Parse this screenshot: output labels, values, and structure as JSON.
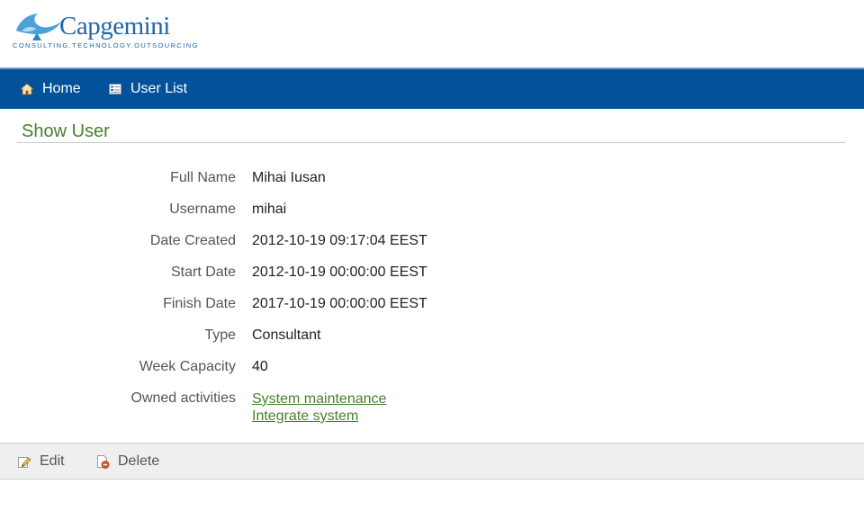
{
  "brand": {
    "name": "Capgemini",
    "tagline": "CONSULTING.TECHNOLOGY.OUTSOURCING",
    "color": "#2166ac"
  },
  "nav": {
    "items": [
      {
        "label": "Home",
        "icon": "home-icon"
      },
      {
        "label": "User List",
        "icon": "list-icon"
      }
    ],
    "background": "#01529b"
  },
  "page": {
    "title": "Show User"
  },
  "user": {
    "fields": [
      {
        "label": "Full Name",
        "value": "Mihai Iusan"
      },
      {
        "label": "Username",
        "value": "mihai"
      },
      {
        "label": "Date Created",
        "value": "2012-10-19 09:17:04 EEST"
      },
      {
        "label": "Start Date",
        "value": "2012-10-19 00:00:00 EEST"
      },
      {
        "label": "Finish Date",
        "value": "2017-10-19 00:00:00 EEST"
      },
      {
        "label": "Type",
        "value": "Consultant"
      },
      {
        "label": "Week Capacity",
        "value": "40"
      }
    ],
    "owned_activities": {
      "label": "Owned activities",
      "items": [
        "System maintenance",
        "Integrate system"
      ]
    }
  },
  "actions": {
    "edit_label": "Edit",
    "delete_label": "Delete"
  },
  "colors": {
    "title_green": "#48802c",
    "link_green": "#48802c",
    "button_bar": "#efefef"
  }
}
